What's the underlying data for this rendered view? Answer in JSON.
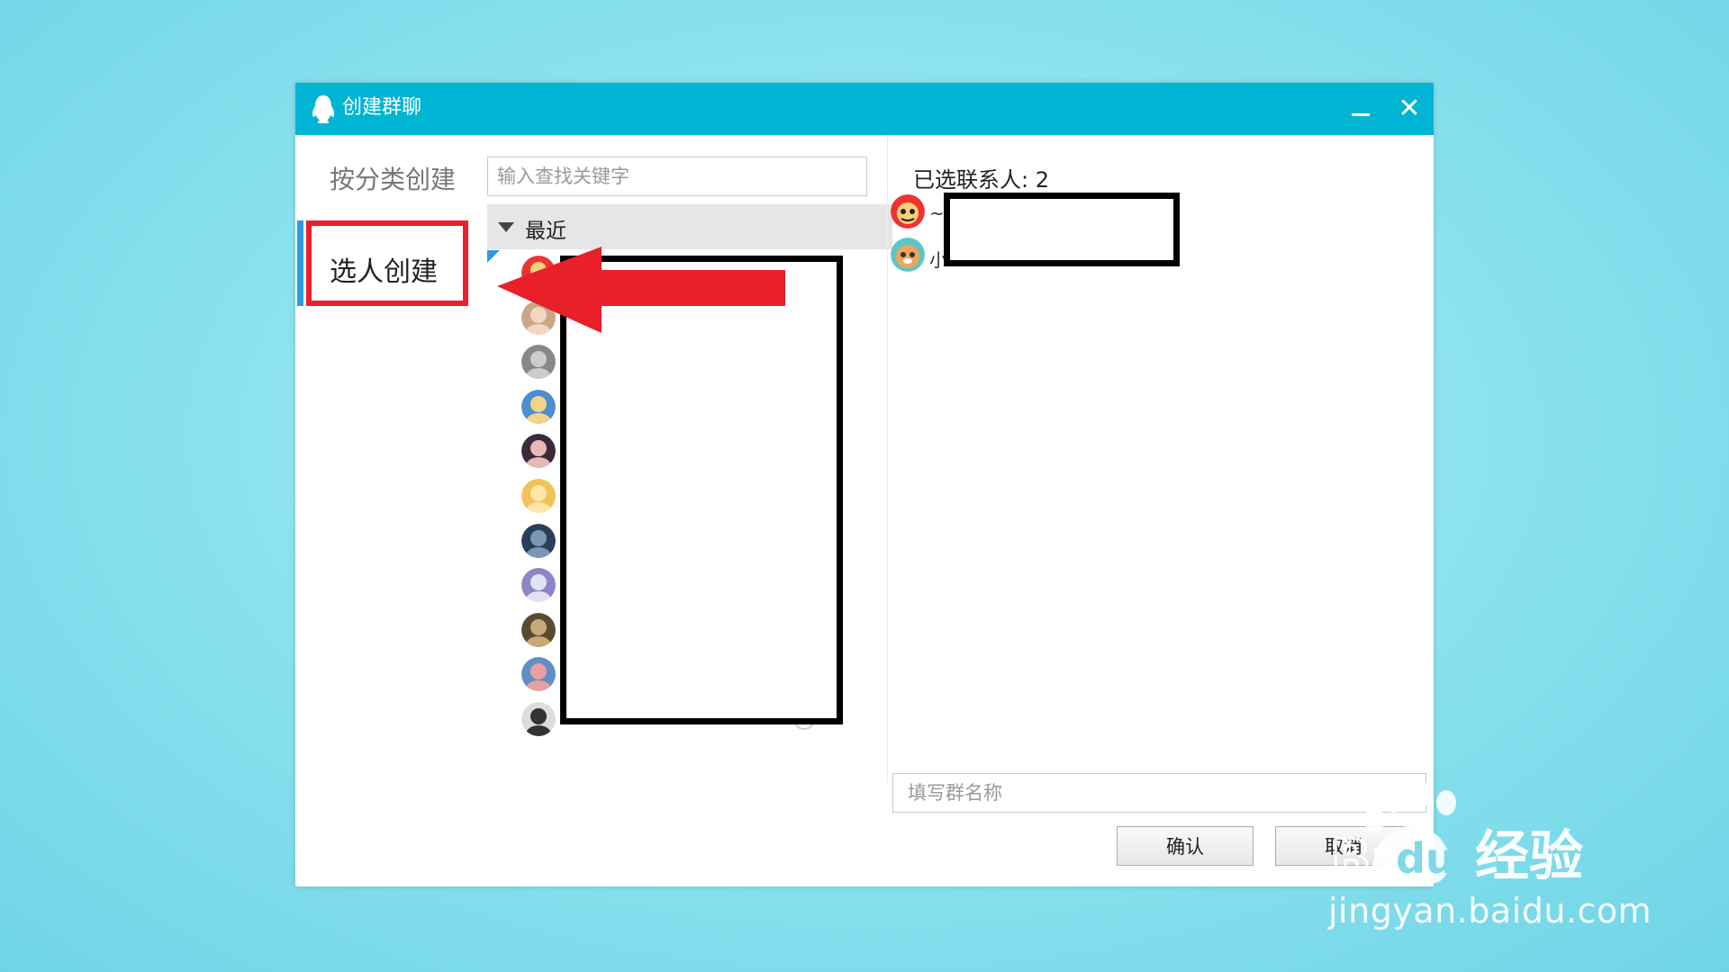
{
  "window": {
    "title": "创建群聊",
    "minimize_label": "minimize",
    "close_label": "close"
  },
  "left_nav": {
    "by_category": "按分类创建",
    "by_person": "选人创建"
  },
  "search": {
    "placeholder": "输入查找关键字"
  },
  "contact_group": {
    "label": "最近",
    "rows": [
      {
        "avatar": "avatar-red-cartoon",
        "checked": true
      },
      {
        "avatar": "avatar-photo-woman",
        "checked": false
      },
      {
        "avatar": "avatar-grey-photo",
        "checked": false
      },
      {
        "avatar": "avatar-blue-cartoon",
        "checked": false
      },
      {
        "avatar": "avatar-anime-dark",
        "checked": false
      },
      {
        "avatar": "avatar-yellow-cartoon",
        "checked": false
      },
      {
        "avatar": "avatar-dark-blue",
        "checked": false
      },
      {
        "avatar": "avatar-purple",
        "checked": false
      },
      {
        "avatar": "avatar-dog",
        "checked": false
      },
      {
        "avatar": "avatar-flower",
        "checked": false
      },
      {
        "avatar": "avatar-girl",
        "checked": false
      }
    ]
  },
  "selected": {
    "title": "已选联系人: 2",
    "items": [
      {
        "avatar": "avatar-red-cartoon",
        "name_prefix": "~"
      },
      {
        "avatar": "avatar-tiger-cartoon",
        "name_prefix": "小"
      }
    ]
  },
  "group_name": {
    "placeholder": "填写群名称"
  },
  "buttons": {
    "confirm": "确认",
    "cancel": "取消"
  },
  "watermark": {
    "brand": "Bai du 经验",
    "url": "jingyan.baidu.com"
  },
  "colors": {
    "titlebar": "#00b5d4",
    "accent": "#2a9be8",
    "highlight_red": "#e8202a",
    "check_blue": "#1aa3e8"
  }
}
